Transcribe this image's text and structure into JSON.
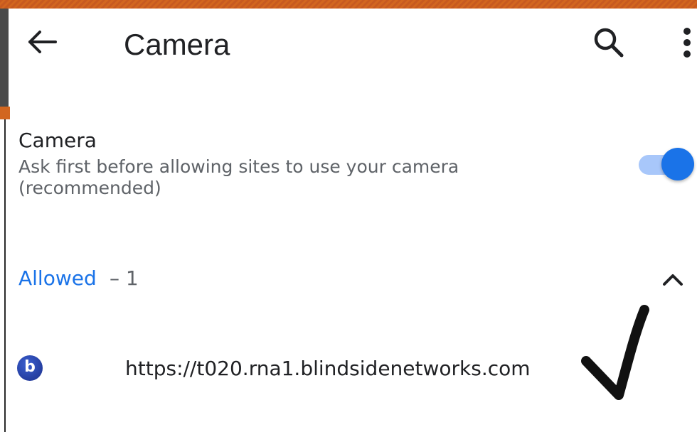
{
  "app_bar": {
    "title": "Camera",
    "back_icon": "arrow-left-icon",
    "search_icon": "search-icon",
    "more_icon": "more-vert-icon"
  },
  "setting": {
    "title": "Camera",
    "description": "Ask first before allowing sites to use your camera (recommended)",
    "toggle_on": true
  },
  "allowed_section": {
    "label": "Allowed",
    "count": "– 1",
    "expanded": true
  },
  "sites": [
    {
      "favicon_letter": "b",
      "url": "https://t020.rna1.blindsidenetworks.com"
    }
  ],
  "colors": {
    "accent": "#1a73e8",
    "toggle_track": "#a8c7fa",
    "banner": "#d2661f"
  }
}
